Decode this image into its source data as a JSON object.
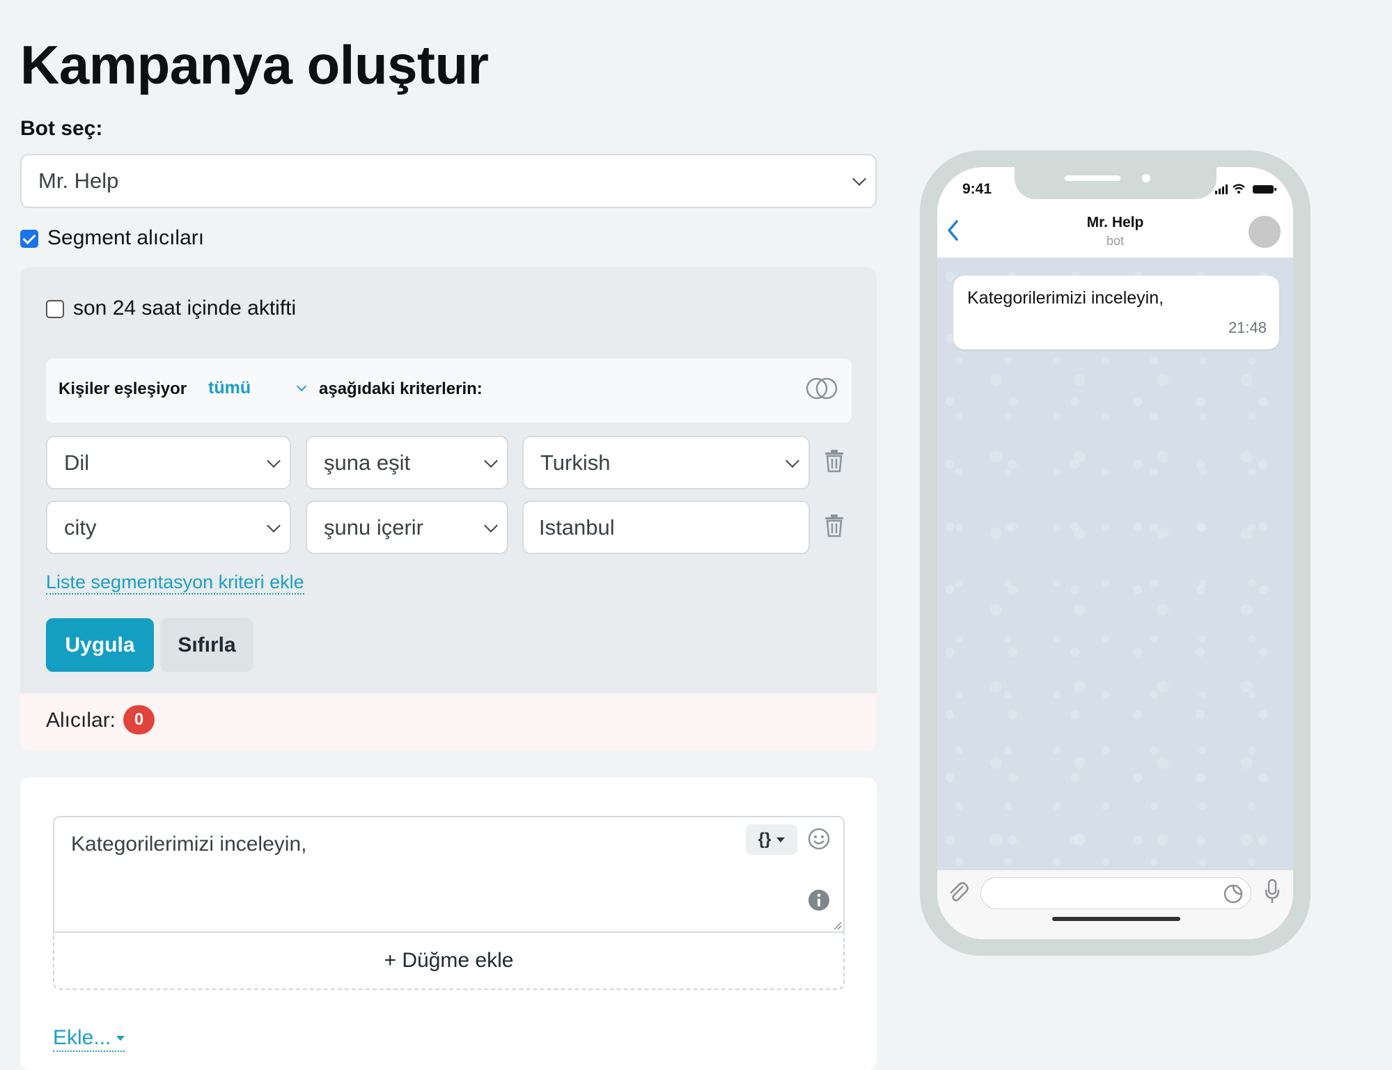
{
  "page": {
    "title": "Kampanya oluştur"
  },
  "bot": {
    "label": "Bot seç:",
    "selected": "Mr. Help"
  },
  "segment": {
    "checkbox_label": "Segment alıcıları",
    "checked": true,
    "active24_label": "son 24 saat içinde aktifti",
    "active24_checked": false,
    "match_prefix": "Kişiler eşleşiyor",
    "match_mode": "tümü",
    "match_suffix": "aşağıdaki kriterlerin:",
    "criteria": [
      {
        "field": "Dil",
        "operator": "şuna eşit",
        "value": "Turkish"
      },
      {
        "field": "city",
        "operator": "şunu içerir",
        "value": "Istanbul"
      }
    ],
    "add_criterion": "Liste segmentasyon kriteri ekle",
    "apply": "Uygula",
    "reset": "Sıfırla"
  },
  "recipients": {
    "label": "Alıcılar:",
    "count": "0"
  },
  "message": {
    "text": "Kategorilerimizi inceleyin,",
    "variables_label": "{}",
    "add_button": "+ Düğme ekle",
    "add_menu": "Ekle..."
  },
  "preview": {
    "status_time": "9:41",
    "chat_name": "Mr. Help",
    "chat_sub": "bot",
    "message_text": "Kategorilerimizi inceleyin,",
    "message_time": "21:48"
  },
  "colors": {
    "accent": "#149fc2",
    "badge": "#e0443c",
    "checkbox": "#1a73e8"
  }
}
